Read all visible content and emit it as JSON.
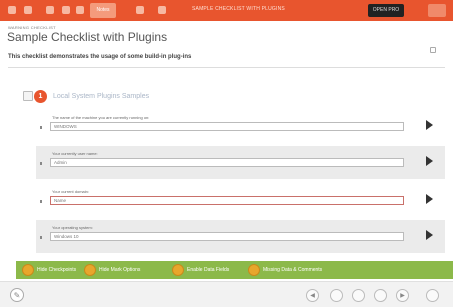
{
  "topbar": {
    "tab_label": "Notes",
    "center_text": "SAMPLE CHECKLIST WITH PLUGINS",
    "dark_button_label": "OPEN PRO"
  },
  "header": {
    "breadcrumb": "WARNING CHECKLIST",
    "title": "Sample Checklist with Plugins",
    "description": "This checklist demonstrates the usage of some build-in plug-ins"
  },
  "section": {
    "number": "1",
    "title": "Local System Plugins Samples"
  },
  "rows": [
    {
      "label": "The name of the machine you are currently running on:",
      "value": "WINDOWS"
    },
    {
      "label": "Your currently user name:",
      "value": "Admin"
    },
    {
      "label": "Your current domain:",
      "value": "Name"
    },
    {
      "label": "Your operating system:",
      "value": "Windows 10"
    }
  ],
  "action_buttons": [
    {
      "label": "Hide Checkpoints"
    },
    {
      "label": "Hide Mark Options"
    },
    {
      "label": "Enable Data Fields"
    },
    {
      "label": "Missing Data & Comments"
    }
  ],
  "bottombar": {
    "edit_glyph": "✎",
    "controls": [
      "◀",
      "▶"
    ]
  },
  "colors": {
    "topbar": "#e8552e",
    "accent": "#e8552e",
    "green_bar": "#8cb94a",
    "button_circle": "#e8a62c"
  }
}
